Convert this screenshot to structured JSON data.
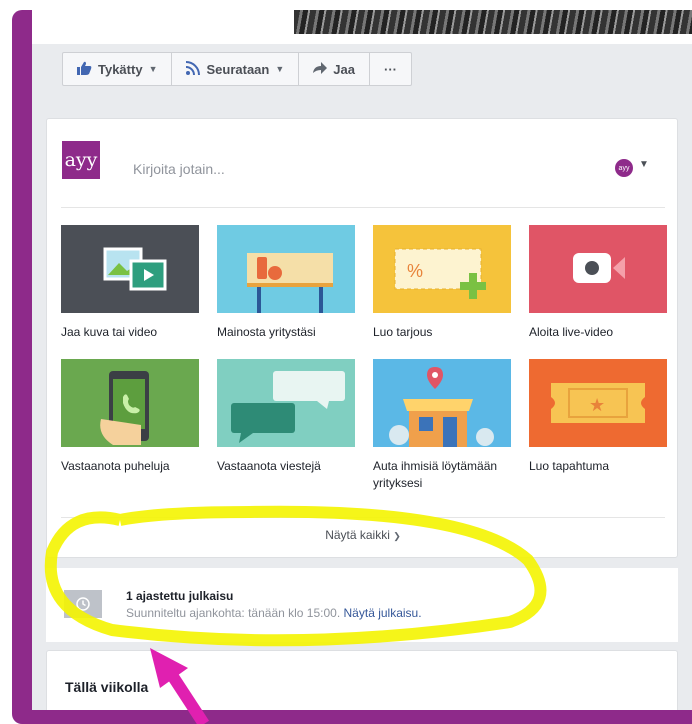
{
  "actions": {
    "liked": "Tykätty",
    "following": "Seurataan",
    "share": "Jaa",
    "more": "···"
  },
  "composer": {
    "logo_text": "ayy",
    "placeholder": "Kirjoita jotain...",
    "avatar_text": "ayy",
    "tiles": [
      {
        "label": "Jaa kuva tai video",
        "icon": "photo-video-icon",
        "color": "#4b4f56"
      },
      {
        "label": "Mainosta yritystäsi",
        "icon": "billboard-icon",
        "color": "#6fcbe3"
      },
      {
        "label": "Luo tarjous",
        "icon": "coupon-icon",
        "color": "#f5c33b"
      },
      {
        "label": "Aloita live-video",
        "icon": "live-video-icon",
        "color": "#e05566"
      },
      {
        "label": "Vastaanota puheluja",
        "icon": "phone-call-icon",
        "color": "#6aa84f"
      },
      {
        "label": "Vastaanota viestejä",
        "icon": "chat-bubbles-icon",
        "color": "#80cfc1"
      },
      {
        "label": "Auta ihmisiä löytämään yrityksesi",
        "icon": "store-pin-icon",
        "color": "#5bb8e6"
      },
      {
        "label": "Luo tapahtuma",
        "icon": "ticket-icon",
        "color": "#ee6a31"
      }
    ],
    "show_all": "Näytä kaikki"
  },
  "scheduled": {
    "title": "1 ajastettu julkaisu",
    "subtitle": "Suunniteltu ajankohta: tänään klo 15:00.",
    "link": "Näytä julkaisu."
  },
  "week": {
    "title": "Tällä viikolla"
  },
  "colors": {
    "frame": "#8e2a8a",
    "highlight": "#f4f400",
    "arrow": "#e020b0",
    "link": "#365899"
  }
}
